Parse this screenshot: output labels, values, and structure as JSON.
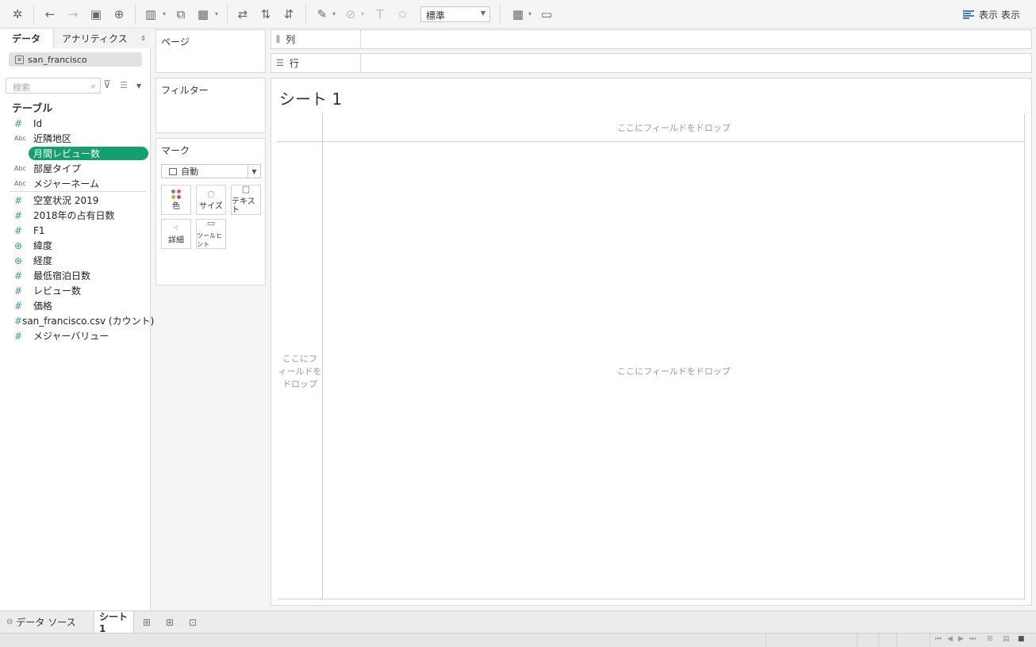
{
  "toolbar": {
    "mark_type_select": "標準",
    "show_me_label": "表示 表示"
  },
  "data_pane": {
    "tab_data": "データ",
    "tab_analytics": "アナリティクス",
    "datasource": "san_francisco",
    "search_placeholder": "検索",
    "tables_heading": "テーブル",
    "fields": [
      {
        "label": "Id",
        "type": "hash"
      },
      {
        "label": "近隣地区",
        "type": "abc"
      },
      {
        "label": "月間レビュー数",
        "type": "hash",
        "selected": true
      },
      {
        "label": "部屋タイプ",
        "type": "abc"
      },
      {
        "label": "メジャーネーム",
        "type": "abc"
      },
      {
        "label": "空室状況 2019",
        "type": "hash"
      },
      {
        "label": "2018年の占有日数",
        "type": "hash"
      },
      {
        "label": "F1",
        "type": "hash"
      },
      {
        "label": "緯度",
        "type": "globe"
      },
      {
        "label": "経度",
        "type": "globe"
      },
      {
        "label": "最低宿泊日数",
        "type": "hash"
      },
      {
        "label": "レビュー数",
        "type": "hash"
      },
      {
        "label": "価格",
        "type": "hash"
      },
      {
        "label": "san_francisco.csv (カウント)",
        "type": "hash"
      },
      {
        "label": "メジャーバリュー",
        "type": "hash"
      }
    ]
  },
  "cards": {
    "pages": "ページ",
    "filters": "フィルター",
    "marks": "マーク",
    "marks_type": "自動",
    "color": "色",
    "size": "サイズ",
    "text": "テキスト",
    "detail": "詳細",
    "tooltip": "ツールヒント"
  },
  "shelves": {
    "columns": "列",
    "rows": "行"
  },
  "sheet": {
    "title": "シート 1",
    "drop_top": "ここにフィールドをドロップ",
    "drop_left": "ここにフ\nィールドを\nドロップ",
    "drop_center": "ここにフィールドをドロップ"
  },
  "bottom": {
    "datasource_tab": "データ ソース",
    "sheet_tab": "シート 1"
  }
}
